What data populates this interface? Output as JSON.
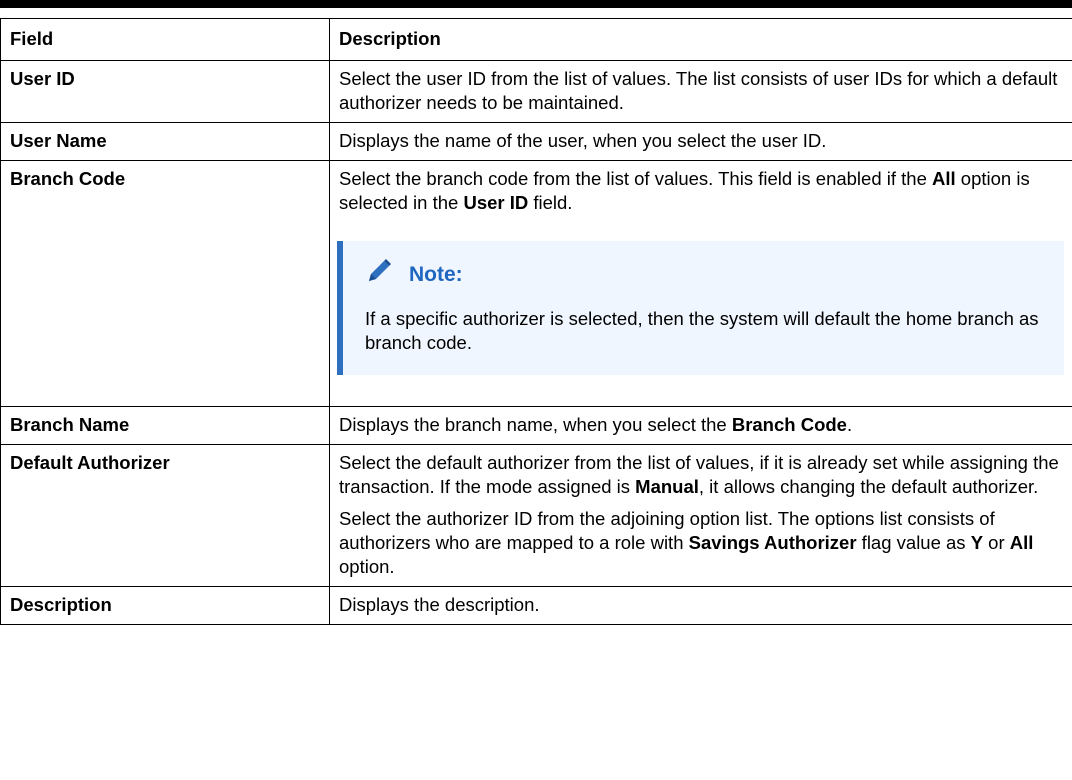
{
  "table": {
    "headers": [
      "Field",
      "Description"
    ],
    "rows": {
      "user_id": {
        "field": "User ID",
        "desc": "Select the user ID from the list of values. The list consists of user IDs for which a default authorizer needs to be maintained."
      },
      "user_name": {
        "field": "User Name",
        "desc": "Displays the name of the user, when you select the user ID."
      },
      "branch_code": {
        "field": "Branch Code",
        "desc_a": "Select the branch code from the list of values. This field is enabled if the ",
        "desc_b": "All",
        "desc_c": " option is selected in the ",
        "desc_d": "User ID",
        "desc_e": " field.",
        "note_title": "Note:",
        "note_text": "If a specific authorizer is selected, then the system will default the home branch as branch code."
      },
      "branch_name": {
        "field": "Branch Name",
        "desc_a": "Displays the branch name, when you select the ",
        "desc_b": "Branch Code",
        "desc_c": "."
      },
      "default_authorizer": {
        "field": "Default Authorizer",
        "p1_a": "Select the default authorizer from the list of values, if it is already set while assigning the transaction. If the mode assigned is ",
        "p1_b": "Manual",
        "p1_c": ", it allows changing the default authorizer.",
        "p2_a": "Select the authorizer ID from the adjoining option list. The options list consists of authorizers who are mapped to a role with ",
        "p2_b": "Savings Authorizer",
        "p2_c": " flag value as ",
        "p2_d": "Y",
        "p2_e": " or ",
        "p2_f": "All",
        "p2_g": " option."
      },
      "description": {
        "field": "Description",
        "desc": "Displays the description."
      }
    },
    "icons": {
      "note": "pencil-icon"
    },
    "colors": {
      "note_accent": "#2f6fc0",
      "note_title": "#1f66c0",
      "note_bg": "#f0f6ff"
    }
  }
}
